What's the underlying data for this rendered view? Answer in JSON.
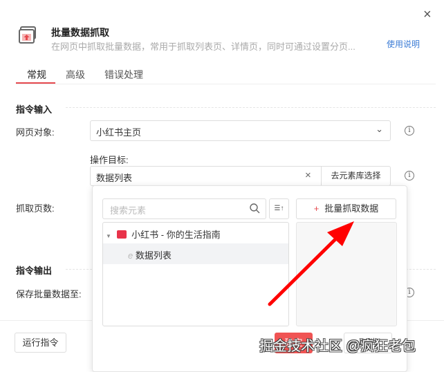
{
  "dialog": {
    "title": "批量数据抓取",
    "subtitle": "在网页中抓取批量数据，常用于抓取列表页、详情页，同时可通过设置分页...",
    "help_link": "使用说明",
    "close": "×"
  },
  "tabs": [
    "常规",
    "高级",
    "错误处理"
  ],
  "input_section": {
    "title": "指令输入",
    "web_object_label": "网页对象:",
    "web_object_value": "小红书主页",
    "target_label": "操作目标:",
    "target_value": "数据列表",
    "element_lib_button": "去元素库选择",
    "pages_label": "抓取页数:"
  },
  "popup": {
    "search_placeholder": "搜索元素",
    "sort_icon": "☰↑",
    "batch_button": "批量抓取数据",
    "tree": [
      {
        "label": "小红书 - 你的生活指南",
        "badge": "小红书"
      },
      {
        "label": "数据列表"
      }
    ],
    "confirm": "确定",
    "cancel": "取消"
  },
  "output_section": {
    "title": "指令输出",
    "save_label": "保存批量数据至:"
  },
  "footer": {
    "run_button": "运行指令"
  },
  "watermark": "掘金技术社区 @疯狂老包",
  "colors": {
    "accent": "#e5484d",
    "link": "#3a7bd5",
    "arrow": "#ff0000"
  }
}
